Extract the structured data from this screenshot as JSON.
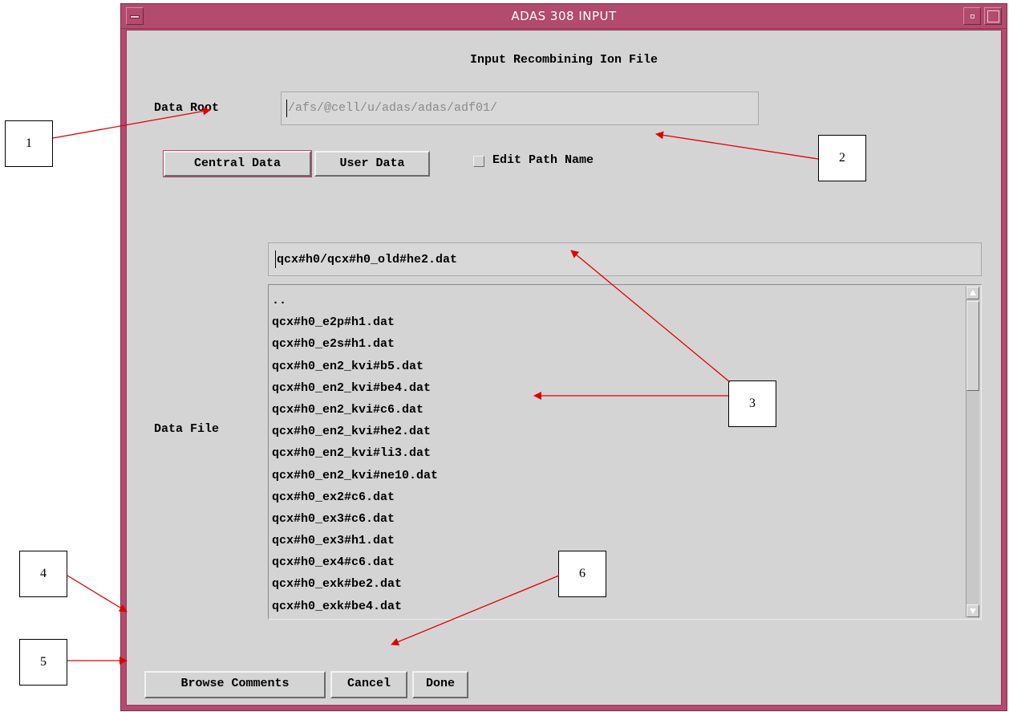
{
  "window": {
    "title": "ADAS 308 INPUT"
  },
  "heading": "Input Recombining Ion File",
  "data_root": {
    "label": "Data Root",
    "value": "/afs/@cell/u/adas/adas/adf01/"
  },
  "source_buttons": {
    "central": "Central Data",
    "user": "User Data"
  },
  "edit_path": {
    "label": "Edit Path Name",
    "checked": false
  },
  "data_file": {
    "label": "Data File",
    "value": "qcx#h0/qcx#h0_old#he2.dat",
    "items": [
      "..",
      "qcx#h0_e2p#h1.dat",
      "qcx#h0_e2s#h1.dat",
      "qcx#h0_en2_kvi#b5.dat",
      "qcx#h0_en2_kvi#be4.dat",
      "qcx#h0_en2_kvi#c6.dat",
      "qcx#h0_en2_kvi#he2.dat",
      "qcx#h0_en2_kvi#li3.dat",
      "qcx#h0_en2_kvi#ne10.dat",
      "qcx#h0_ex2#c6.dat",
      "qcx#h0_ex3#c6.dat",
      "qcx#h0_ex3#h1.dat",
      "qcx#h0_ex4#c6.dat",
      "qcx#h0_exk#be2.dat",
      "qcx#h0_exk#be4.dat"
    ]
  },
  "bottom_buttons": {
    "browse": "Browse Comments",
    "cancel": "Cancel",
    "done": "Done"
  },
  "callouts": [
    "1",
    "2",
    "3",
    "4",
    "5",
    "6"
  ],
  "colors": {
    "titlebar": "#b24b6d",
    "panel": "#d4d4d4",
    "arrow": "#e00000"
  }
}
